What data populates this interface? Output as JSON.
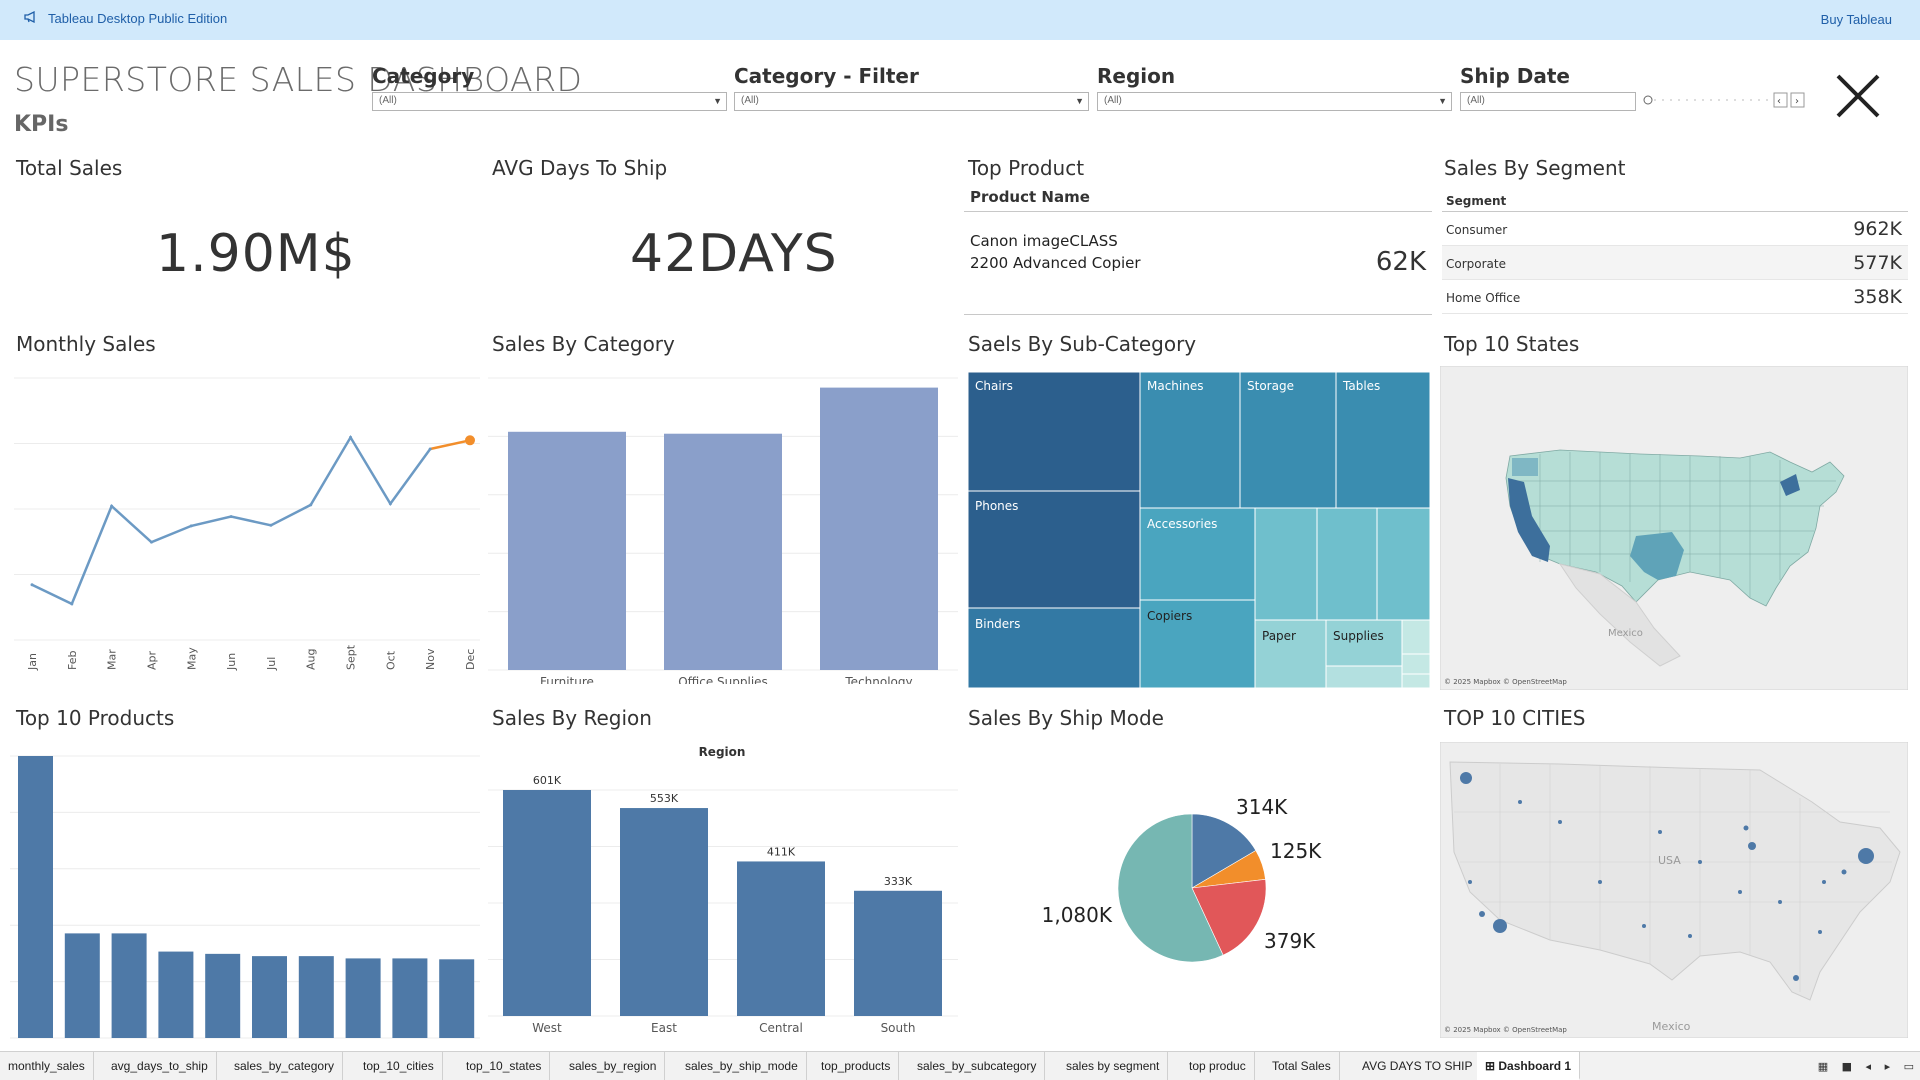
{
  "topbar": {
    "edition": "Tableau Desktop Public Edition",
    "buy": "Buy Tableau",
    "icon": "megaphone-icon"
  },
  "dashboard": {
    "title": "SUPERSTORE SALES DASHBOARD",
    "kpis_label": "KPIs"
  },
  "filters": [
    {
      "title": "Category",
      "value": "(All)"
    },
    {
      "title": "Category - Filter",
      "value": "(All)"
    },
    {
      "title": "Region",
      "value": "(All)"
    },
    {
      "title": "Ship Date",
      "value": "(All)"
    }
  ],
  "kpis": {
    "total_sales_title": "Total Sales",
    "total_sales_value": "1.90M$",
    "avg_days_title": "AVG Days To Ship",
    "avg_days_value": "42DAYS",
    "top_product_title": "Top Product",
    "top_product_header": "Product Name",
    "top_product_name": "Canon imageCLASS 2200 Advanced Copier",
    "top_product_value": "62K",
    "segment_title": "Sales By Segment",
    "segment_header": "Segment",
    "segments": [
      {
        "name": "Consumer",
        "value": "962K"
      },
      {
        "name": "Corporate",
        "value": "577K"
      },
      {
        "name": "Home Office",
        "value": "358K"
      }
    ]
  },
  "titles": {
    "monthly_sales": "Monthly Sales",
    "sales_by_category": "Sales By Category",
    "sales_by_subcategory": "Saels By Sub-Category",
    "top_states": "Top 10 States",
    "top_products": "Top 10 Products",
    "sales_by_region": "Sales By Region",
    "sales_by_ship_mode": "Sales By Ship Mode",
    "top_cities": "TOP 10 CITIES"
  },
  "map": {
    "attribution": "© 2025 Mapbox © OpenStreetMap",
    "states_label": "Mexico",
    "cities_label_usa": "USA",
    "cities_label_mexico": "Mexico"
  },
  "colors": {
    "accent_blue": "#4e79a7",
    "light_bar": "#8a9fca",
    "teal": "#76b7b2",
    "red": "#e15759",
    "orange": "#f28e2b",
    "line": "#6c9ac4"
  },
  "chart_data": [
    {
      "id": "monthly_sales",
      "type": "line",
      "title": "Monthly Sales",
      "categories": [
        "Jan",
        "Feb",
        "Mar",
        "Apr",
        "May",
        "Jun",
        "Jul",
        "Aug",
        "Sept",
        "Oct",
        "Nov",
        "Dec"
      ],
      "values": [
        95,
        62,
        230,
        168,
        196,
        212,
        197,
        232,
        348,
        234,
        328,
        343
      ],
      "ylim": [
        0,
        450
      ],
      "grid": true
    },
    {
      "id": "sales_by_category",
      "type": "bar",
      "title": "Sales By Category",
      "categories": [
        "Furniture",
        "Office Supplies",
        "Technology"
      ],
      "values": [
        620,
        615,
        735
      ],
      "ylim": [
        0,
        760
      ]
    },
    {
      "id": "sales_by_subcategory",
      "type": "treemap",
      "title": "Saels By Sub-Category",
      "categories": [
        "Chairs",
        "Phones",
        "Binders",
        "Machines",
        "Storage",
        "Tables",
        "Accessories",
        "Copiers",
        "Paper",
        "Supplies"
      ]
    },
    {
      "id": "top_products",
      "type": "bar",
      "title": "Top 10 Products",
      "values": [
        62,
        23,
        23,
        19,
        18.5,
        18,
        18,
        17.5,
        17.5,
        17.3
      ],
      "ylim": [
        0,
        62
      ]
    },
    {
      "id": "sales_by_region",
      "type": "bar",
      "title": "Sales By Region",
      "header": "Region",
      "categories": [
        "West",
        "East",
        "Central",
        "South"
      ],
      "values": [
        601,
        553,
        411,
        333
      ],
      "labels": [
        "601K",
        "553K",
        "411K",
        "333K"
      ],
      "ylim": [
        0,
        601
      ]
    },
    {
      "id": "sales_by_ship_mode",
      "type": "pie",
      "title": "Sales By Ship Mode",
      "values": [
        314,
        125,
        379,
        1080
      ],
      "labels": [
        "314K",
        "125K",
        "379K",
        "1,080K"
      ]
    }
  ],
  "tabs": [
    "monthly_sales",
    "avg_days_to_ship",
    "sales_by_category",
    "top_10_cities",
    "top_10_states",
    "sales_by_region",
    "sales_by_ship_mode",
    "top_products",
    "sales_by_subcategory",
    "sales by segment",
    "top produc",
    "Total Sales",
    "AVG DAYS TO SHIP",
    "Dashboard 1"
  ]
}
